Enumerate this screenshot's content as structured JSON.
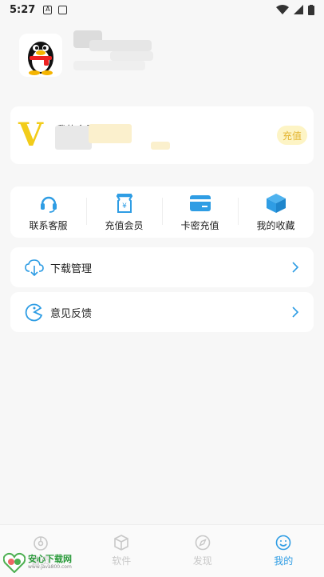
{
  "status_bar": {
    "time": "5:27"
  },
  "profile": {
    "avatar": "qq-penguin-avatar",
    "username_blurred": true
  },
  "vip": {
    "label": "我的会员",
    "recharge_label": "充值",
    "accent": "#f2cc1a"
  },
  "quick_actions": [
    {
      "label": "联系客服",
      "icon": "headset-icon"
    },
    {
      "label": "充值会员",
      "icon": "yen-bag-icon"
    },
    {
      "label": "卡密充值",
      "icon": "card-icon"
    },
    {
      "label": "我的收藏",
      "icon": "box-icon"
    }
  ],
  "menu": [
    {
      "label": "下载管理",
      "icon": "cloud-download-icon"
    },
    {
      "label": "意见反馈",
      "icon": "feedback-icon"
    }
  ],
  "tabs": [
    {
      "label": "首页",
      "icon": "home-icon",
      "active": false
    },
    {
      "label": "软件",
      "icon": "cube-icon",
      "active": false
    },
    {
      "label": "发现",
      "icon": "compass-icon",
      "active": false
    },
    {
      "label": "我的",
      "icon": "smile-icon",
      "active": true
    }
  ],
  "watermark": {
    "title": "安心下载网",
    "url": "www.java800.com"
  },
  "colors": {
    "brand_blue": "#2f9de4",
    "background": "#f7f7f7"
  }
}
